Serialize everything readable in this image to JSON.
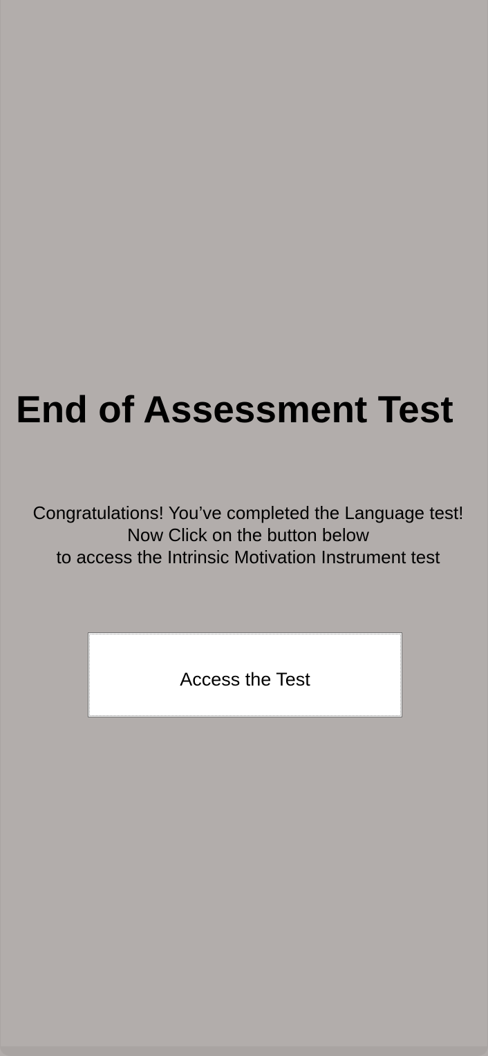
{
  "page": {
    "title": "End of Assessment Test",
    "message_lines": [
      "Congratulations! You’ve completed the Language test!",
      "Now Click on the button below",
      "to access the Intrinsic Motivation Instrument test"
    ],
    "button_label": "Access the Test"
  },
  "colors": {
    "background": "#b2adab",
    "button_background": "#ffffff",
    "text": "#000000"
  }
}
